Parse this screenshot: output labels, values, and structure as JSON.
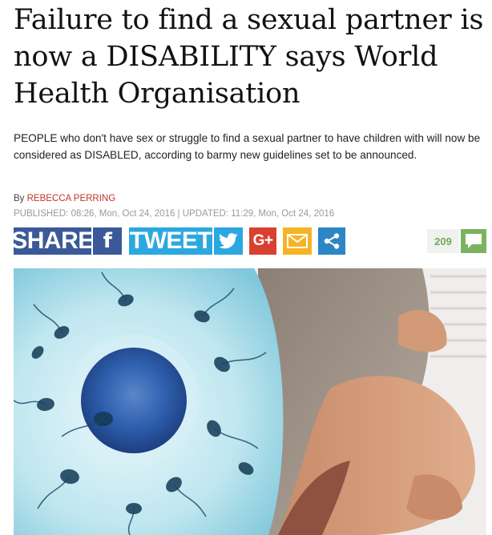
{
  "article": {
    "headline": "Failure to find a sexual partner is now a DISABILITY says World Health Organisation",
    "standfirst": "PEOPLE who don't have sex or struggle to find a sexual partner to have children with will now be considered as DISABLED, according to barmy new guidelines set to be announced.",
    "byline_prefix": "By ",
    "author": "REBECCA PERRING",
    "dateline": "PUBLISHED: 08:26, Mon, Oct 24, 2016 | UPDATED: 11:29, Mon, Oct 24, 2016"
  },
  "share": {
    "facebook_label": "SHARE",
    "facebook_icon": "f",
    "twitter_label": "TWEET",
    "googleplus_label": "G+",
    "colors": {
      "facebook": "#3b5998",
      "twitter": "#2ba8e0",
      "googleplus": "#d8412f",
      "email": "#f4b425",
      "more": "#2c86c5"
    }
  },
  "comments": {
    "count": "209",
    "accent": "#7cb35f"
  },
  "hero": {
    "left_image": "sperm-and-egg-illustration",
    "right_image": "pregnant-woman-photo"
  }
}
